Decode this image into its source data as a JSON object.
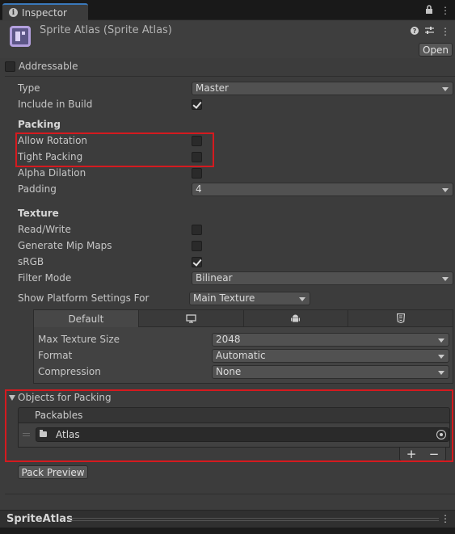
{
  "tab": {
    "title": "Inspector",
    "lock_icon": "lock-icon",
    "menu_icon": "kebab-menu-icon"
  },
  "header": {
    "title": "Sprite Atlas (Sprite Atlas)",
    "help_icon": "help-icon",
    "settings_icon": "preset-sliders-icon",
    "menu_icon": "kebab-menu-icon",
    "open_label": "Open"
  },
  "addressable": {
    "label": "Addressable",
    "checked": false
  },
  "fields": {
    "type": {
      "label": "Type",
      "value": "Master"
    },
    "include_in_build": {
      "label": "Include in Build",
      "checked": true
    }
  },
  "packing": {
    "title": "Packing",
    "allow_rotation": {
      "label": "Allow Rotation",
      "checked": false
    },
    "tight_packing": {
      "label": "Tight Packing",
      "checked": false
    },
    "alpha_dilation": {
      "label": "Alpha Dilation",
      "checked": false
    },
    "padding": {
      "label": "Padding",
      "value": "4"
    }
  },
  "texture": {
    "title": "Texture",
    "read_write": {
      "label": "Read/Write",
      "checked": false
    },
    "generate_mip_maps": {
      "label": "Generate Mip Maps",
      "checked": false
    },
    "srgb": {
      "label": "sRGB",
      "checked": true
    },
    "filter_mode": {
      "label": "Filter Mode",
      "value": "Bilinear"
    }
  },
  "platform": {
    "label": "Show Platform Settings For",
    "value": "Main Texture",
    "tabs": [
      {
        "label": "Default",
        "icon": ""
      },
      {
        "label": "",
        "icon": "monitor-icon"
      },
      {
        "label": "",
        "icon": "android-icon"
      },
      {
        "label": "",
        "icon": "webgl-html5-icon"
      }
    ],
    "max_texture_size": {
      "label": "Max Texture Size",
      "value": "2048"
    },
    "format": {
      "label": "Format",
      "value": "Automatic"
    },
    "compression": {
      "label": "Compression",
      "value": "None"
    }
  },
  "objects": {
    "title": "Objects for Packing",
    "list_header": "Packables",
    "items": [
      {
        "name": "Atlas",
        "icon": "folder-icon"
      }
    ],
    "add_label": "+",
    "remove_label": "−"
  },
  "pack_preview_label": "Pack Preview",
  "bottom": {
    "title": "SpriteAtlas",
    "menu_icon": "kebab-menu-icon"
  },
  "colors": {
    "highlight": "#d51a1f",
    "accent": "#3a79bb",
    "background": "#3c3c3c"
  }
}
